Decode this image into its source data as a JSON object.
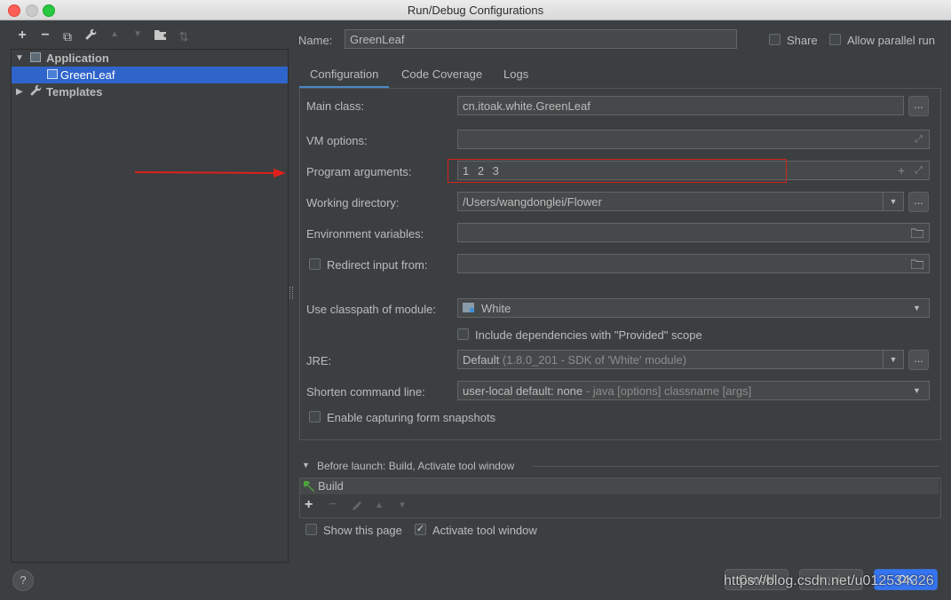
{
  "window": {
    "title": "Run/Debug Configurations"
  },
  "toolbar": {
    "add": "+",
    "remove": "−",
    "copy": "⧉",
    "edit": "🔧",
    "up": "▲",
    "down": "▼",
    "folder": "📁",
    "sort": "⇅"
  },
  "tree": {
    "items": [
      {
        "label": "Application",
        "expanded": true,
        "icon": "application-icon"
      },
      {
        "label": "GreenLeaf",
        "selected": true,
        "icon": "config-icon"
      },
      {
        "label": "Templates",
        "expanded": false,
        "icon": "wrench-icon"
      }
    ]
  },
  "header": {
    "name_label": "Name:",
    "name_value": "GreenLeaf",
    "share_label": "Share",
    "parallel_label": "Allow parallel run"
  },
  "tabs": [
    {
      "label": "Configuration",
      "selected": true
    },
    {
      "label": "Code Coverage",
      "selected": false
    },
    {
      "label": "Logs",
      "selected": false
    }
  ],
  "form": {
    "main_class_label": "Main class:",
    "main_class_value": "cn.itoak.white.GreenLeaf",
    "vm_options_label": "VM options:",
    "vm_options_value": "",
    "program_args_label": "Program arguments:",
    "program_args_value": "1 2 3",
    "working_dir_label": "Working directory:",
    "working_dir_value": "/Users/wangdonglei/Flower",
    "env_vars_label": "Environment variables:",
    "env_vars_value": "",
    "redirect_label": "Redirect input from:",
    "redirect_value": "",
    "classpath_label": "Use classpath of module:",
    "classpath_value": "White",
    "include_deps_label": "Include dependencies with \"Provided\" scope",
    "jre_label": "JRE:",
    "jre_value": "Default",
    "jre_detail": "(1.8.0_201 - SDK of 'White' module)",
    "shorten_label": "Shorten command line:",
    "shorten_value": "user-local default: none",
    "shorten_detail": "- java [options] classname [args]",
    "snapshots_label": "Enable capturing form snapshots",
    "browse": "..."
  },
  "before_launch": {
    "title": "Before launch: Build, Activate tool window",
    "items": [
      {
        "label": "Build",
        "icon": "hammer-icon"
      }
    ],
    "show_page_label": "Show this page",
    "activate_label": "Activate tool window",
    "activate_checked": true
  },
  "footer": {
    "help": "?",
    "cancel": "Cancel",
    "apply": "Apply",
    "ok": "OK",
    "watermark": "https://blog.csdn.net/u012534326"
  },
  "colors": {
    "accent": "#4a88c7",
    "selection": "#2f65ca",
    "annotation": "#e0201c",
    "ok": "#3574f0"
  }
}
